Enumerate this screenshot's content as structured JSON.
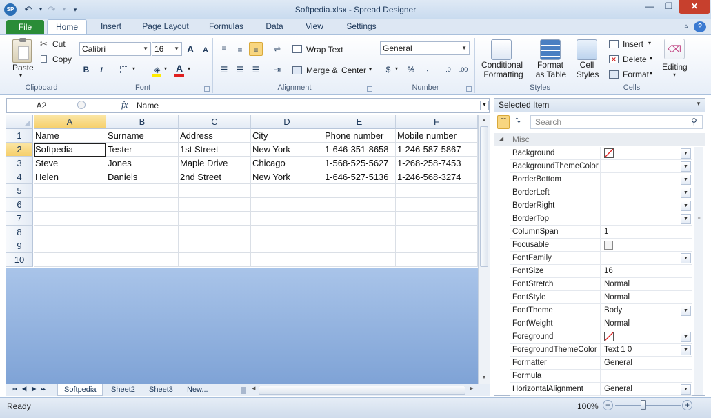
{
  "window": {
    "title": "Softpedia.xlsx - Spread Designer",
    "app_badge": "SP"
  },
  "tabs": [
    "File",
    "Home",
    "Insert",
    "Page Layout",
    "Formulas",
    "Data",
    "View",
    "Settings"
  ],
  "ribbon": {
    "clipboard": {
      "label": "Clipboard",
      "paste": "Paste",
      "cut": "Cut",
      "copy": "Copy"
    },
    "font": {
      "label": "Font",
      "family": "Calibri",
      "size": "16",
      "bold": "B",
      "italic": "I",
      "grow": "A",
      "shrink": "A"
    },
    "alignment": {
      "label": "Alignment",
      "wrap": "Wrap Text",
      "merge": "Merge &",
      "center": "Center"
    },
    "number": {
      "label": "Number",
      "format": "General",
      "percent": "%",
      "comma": ","
    },
    "styles": {
      "label": "Styles",
      "conditional1": "Conditional",
      "conditional2": "Formatting",
      "table1": "Format",
      "table2": "as Table",
      "cell1": "Cell",
      "cell2": "Styles"
    },
    "cells": {
      "label": "Cells",
      "insert": "Insert",
      "delete": "Delete",
      "format": "Format"
    },
    "editing": {
      "label": "Editing"
    }
  },
  "formula_bar": {
    "cell_ref": "A2",
    "fx": "fx",
    "content": "Name"
  },
  "grid": {
    "columns": [
      "A",
      "B",
      "C",
      "D",
      "E",
      "F"
    ],
    "selected_column": "A",
    "selected_row": "2",
    "rows": [
      {
        "num": "1",
        "cells": [
          "Name",
          "Surname",
          "Address",
          "City",
          "Phone number",
          "Mobile number"
        ]
      },
      {
        "num": "2",
        "cells": [
          "Softpedia",
          "Tester",
          "1st Street",
          "New York",
          "1-646-351-8658",
          "1-246-587-5867"
        ]
      },
      {
        "num": "3",
        "cells": [
          "Steve",
          "Jones",
          "Maple Drive",
          "Chicago",
          "1-568-525-5627",
          "1-268-258-7453"
        ]
      },
      {
        "num": "4",
        "cells": [
          "Helen",
          "Daniels",
          "2nd Street",
          "New York",
          "1-646-527-5136",
          "1-246-568-3274"
        ]
      },
      {
        "num": "5",
        "cells": [
          "",
          "",
          "",
          "",
          "",
          ""
        ]
      },
      {
        "num": "6",
        "cells": [
          "",
          "",
          "",
          "",
          "",
          ""
        ]
      },
      {
        "num": "7",
        "cells": [
          "",
          "",
          "",
          "",
          "",
          ""
        ]
      },
      {
        "num": "8",
        "cells": [
          "",
          "",
          "",
          "",
          "",
          ""
        ]
      },
      {
        "num": "9",
        "cells": [
          "",
          "",
          "",
          "",
          "",
          ""
        ]
      },
      {
        "num": "10",
        "cells": [
          "",
          "",
          "",
          "",
          "",
          ""
        ]
      }
    ]
  },
  "sheets": [
    "Softpedia",
    "Sheet2",
    "Sheet3",
    "New..."
  ],
  "status": {
    "ready": "Ready",
    "zoom": "100%"
  },
  "panel": {
    "title": "Selected Item",
    "search_placeholder": "Search",
    "category": "Misc",
    "properties": [
      {
        "name": "Background",
        "value": "",
        "kind": "swatch",
        "dropdown": true
      },
      {
        "name": "BackgroundThemeColor",
        "value": "",
        "kind": "text",
        "dropdown": true
      },
      {
        "name": "BorderBottom",
        "value": "",
        "kind": "text",
        "dropdown": true
      },
      {
        "name": "BorderLeft",
        "value": "",
        "kind": "text",
        "dropdown": true
      },
      {
        "name": "BorderRight",
        "value": "",
        "kind": "text",
        "dropdown": true
      },
      {
        "name": "BorderTop",
        "value": "",
        "kind": "text",
        "dropdown": true
      },
      {
        "name": "ColumnSpan",
        "value": "1",
        "kind": "text",
        "dropdown": false
      },
      {
        "name": "Focusable",
        "value": "",
        "kind": "checkbox",
        "dropdown": false
      },
      {
        "name": "FontFamily",
        "value": "",
        "kind": "text",
        "dropdown": true
      },
      {
        "name": "FontSize",
        "value": "16",
        "kind": "text",
        "dropdown": false
      },
      {
        "name": "FontStretch",
        "value": "Normal",
        "kind": "text",
        "dropdown": false
      },
      {
        "name": "FontStyle",
        "value": "Normal",
        "kind": "text",
        "dropdown": false
      },
      {
        "name": "FontTheme",
        "value": "Body",
        "kind": "text",
        "dropdown": true
      },
      {
        "name": "FontWeight",
        "value": "Normal",
        "kind": "text",
        "dropdown": false
      },
      {
        "name": "Foreground",
        "value": "",
        "kind": "swatch",
        "dropdown": true
      },
      {
        "name": "ForegroundThemeColor",
        "value": "Text 1 0",
        "kind": "text",
        "dropdown": true
      },
      {
        "name": "Formatter",
        "value": "General",
        "kind": "text",
        "dropdown": false
      },
      {
        "name": "Formula",
        "value": "",
        "kind": "text",
        "dropdown": false
      },
      {
        "name": "HorizontalAlignment",
        "value": "General",
        "kind": "text",
        "dropdown": true
      }
    ]
  },
  "colors": {
    "file_tab": "#2a8c37",
    "selection": "#f6cf6a",
    "grid_background": "#7fa3d6"
  }
}
